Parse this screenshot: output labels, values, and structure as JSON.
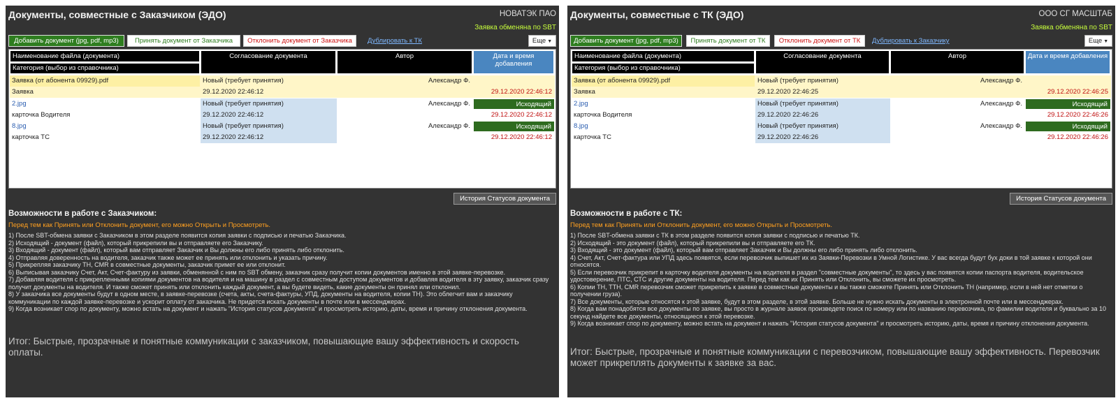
{
  "left": {
    "title": "Документы, совместные с Заказчиком (ЭДО)",
    "company": "НОВАТЭК ПАО",
    "exchanged": "Заявка обменяна по SBT",
    "buttons": {
      "add": "Добавить документ (jpg, pdf, mp3)",
      "accept": "Принять документ от Заказчика",
      "reject": "Отклонить документ от Заказчика",
      "duplicate": "Дублировать к ТК",
      "more": "Еще",
      "history": "История Статусов документа"
    },
    "headers": {
      "name": "Наименование файла (документа)",
      "category": "Категория (выбор из справочника)",
      "agreement": "Согласование документа",
      "author": "Автор",
      "date": "Дата и время добавления"
    },
    "rows": [
      {
        "name": "Заявка (от абонента 09929).pdf",
        "category": "Заявка",
        "status": "Новый (требует принятия)",
        "status_time": "29.12.2020 22:46:12",
        "author": "Александр Ф.",
        "badge": "",
        "date": "29.12.2020 22:46:12"
      },
      {
        "name": "2.jpg",
        "category": "карточка Водителя",
        "status": "Новый (требует принятия)",
        "status_time": "29.12.2020 22:46:12",
        "author": "Александр Ф.",
        "badge": "Исходящий",
        "date": "29.12.2020 22:46:12"
      },
      {
        "name": "8.jpg",
        "category": "карточка ТС",
        "status": "Новый (требует принятия)",
        "status_time": "29.12.2020 22:46:12",
        "author": "Александр Ф.",
        "badge": "Исходящий",
        "date": "29.12.2020 22:46:12"
      }
    ],
    "opportunities_title": "Возможности в работе с Заказчиком:",
    "note": "Перед тем как Принять или Отклонить документ, его можно Открыть и Просмотреть.",
    "list": [
      "1) После SBT-обмена заявки с Заказчиком в этом разделе появится копия заявки с подписью и печатью Заказчика.",
      "2) Исходящий - документ (файл), который прикрепили вы и отправляете его Заказчику.",
      "3) Входящий - документ (файл), который вам отправляет Заказчик и Вы должны его либо принять либо отклонить.",
      "4) Отправляя доверенность на водителя, заказчик также может ее принять или отклонить и указать причину.",
      "5) Прикрепляя заказчику ТН, CMR в совместные документы, заказчик примет ее или отклонит.",
      "6) Выписывая заказчику Счет, Акт, Счет-фактуру из заявки, обменянной с ним по SBT обмену, заказчик сразу получит копии документов именно в этой заявке-перевозке.",
      "7) Добавляя водителя с прикрепленными копиями документов на водителя и на машину в раздел с совместным доступом документов и добавляя водителя в эту заявку, заказчик сразу получит документы на водителя. И также сможет принять или отклонить каждый документ, а вы будете видеть, какие документы он принял или отклонил.",
      "8) У заказчика все документы будут в одном месте, в заявке-перевозке (счета, акты, счета-фактуры, УПД, документы на водителя, копии ТН). Это облегчит вам и заказчику коммуникации по каждой заявке-перевозке и ускорит оплату от заказчика. Не придется искать документы в почте или в мессенджерах.",
      "9) Когда возникает спор по документу, можно встать на документ и нажать \"История статусов документа\" и просмотреть историю, даты, время и причину отклонения документа."
    ],
    "summary": "Итог: Быстрые, прозрачные и понятные коммуникации с заказчиком, повышающие вашу эффективность и скорость оплаты."
  },
  "right": {
    "title": "Документы, совместные с ТК (ЭДО)",
    "company": "ООО СГ МАСШТАБ",
    "exchanged": "Заявка обменяна по SBT",
    "buttons": {
      "add": "Добавить документ (jpg, pdf, mp3)",
      "accept": "Принять документ от ТК",
      "reject": "Отклонить документ от ТК",
      "duplicate": "Дублировать к Заказчику",
      "more": "Еще",
      "history": "История Статусов документа"
    },
    "headers": {
      "name": "Наименование файла (документа)",
      "category": "Категория (выбор из справочника)",
      "agreement": "Согласование документа",
      "author": "Автор",
      "date": "Дата и время добавления"
    },
    "rows": [
      {
        "name": "Заявка (от абонента 09929).pdf",
        "category": "Заявка",
        "status": "Новый (требует принятия)",
        "status_time": "29.12.2020 22:46:25",
        "author": "Александр Ф.",
        "badge": "",
        "date": "29.12.2020 22:46:25"
      },
      {
        "name": "2.jpg",
        "category": "карточка Водителя",
        "status": "Новый (требует принятия)",
        "status_time": "29.12.2020 22:46:26",
        "author": "Александр Ф.",
        "badge": "Исходящий",
        "date": "29.12.2020 22:46:26"
      },
      {
        "name": "8.jpg",
        "category": "карточка ТС",
        "status": "Новый (требует принятия)",
        "status_time": "29.12.2020 22:46:26",
        "author": "Александр Ф.",
        "badge": "Исходящий",
        "date": "29.12.2020 22:46:26"
      }
    ],
    "opportunities_title": "Возможности в работе с ТК:",
    "note": "Перед тем как Принять или Отклонить документ, его можно Открыть и Просмотреть.",
    "list": [
      "1) После SBT-обмена заявки с ТК в этом разделе появится копия заявки с подписью и печатью ТК.",
      "2) Исходящий - это документ (файл), который прикрепили вы и отправляете его ТК.",
      "3) Входящий - это документ (файл), который вам отправляет Заказчик и Вы должны его либо принять либо отклонить.",
      "4) Счет, Акт, Счет-фактура или УПД здесь появятся, если перевозчик выпишет их из Заявки-Перевозки в Умной Логистике. У вас всегда будут бух доки в той заявке к которой они относятся.",
      "5) Если перевозчик прикрепит в карточку водителя документы на водителя в раздел \"совместные документы\", то здесь у вас появятся копии паспорта водителя, водительское удостоверение, ПТС, СТС и другие документы на водителя. Перед тем как их Принять или Отклонить, вы сможете их просмотреть.",
      "6) Копии ТН, ТТН, CMR перевозчик сможет прикрепить к заявке в совместные документы и вы также сможете Принять или Отклонить ТН (например, если в ней нет отметки о получении груза).",
      "7) Все документы, которые относятся к этой заявке, будут в этом разделе, в этой заявке. Больше не нужно искать документы в электронной почте или в мессенджерах.",
      "8) Когда вам понадобятся все документы по заявке, вы просто в журнале заявок произведете поиск по номеру или по названию перевозчика, по фамилии водителя и буквально за 10 секунд найдете все документы, относящиеся к этой перевозке.",
      "9) Когда возникает спор по документу, можно встать на документ и нажать \"История статусов документа\" и просмотреть историю, даты, время и причину отклонения документа."
    ],
    "summary": "Итог: Быстрые, прозрачные и понятные коммуникации с перевозчиком, повышающие вашу эффективность. Перевозчик может прикреплять документы к заявке за вас."
  }
}
